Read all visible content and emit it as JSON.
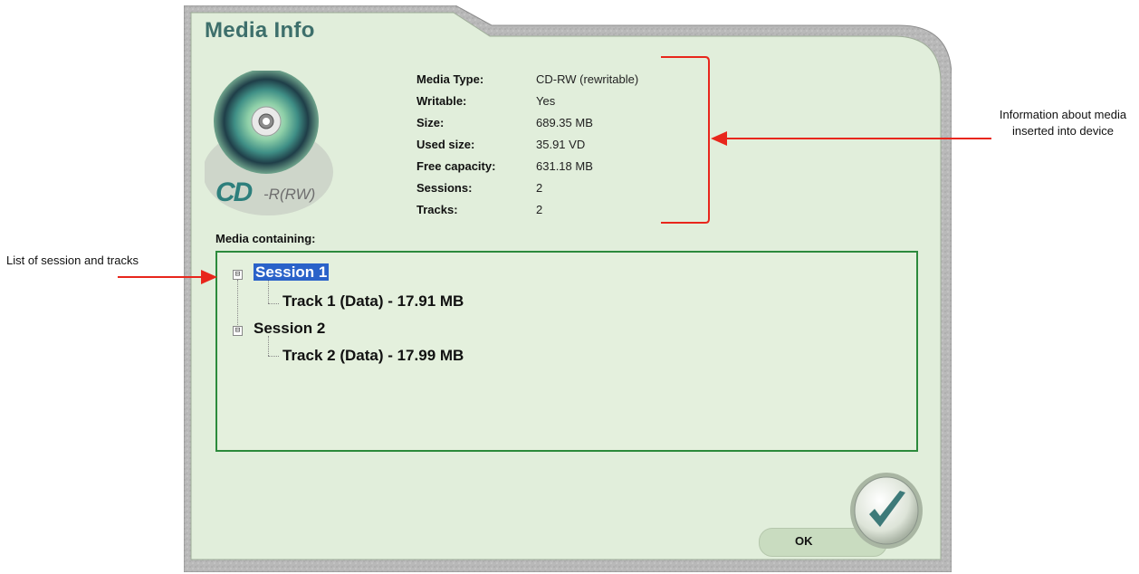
{
  "dialog": {
    "title": "Media Info",
    "logo_text": "CD",
    "logo_sub": "-R(RW)"
  },
  "info": [
    {
      "label": "Media Type:",
      "value": "CD-RW (rewritable)"
    },
    {
      "label": "Writable:",
      "value": "Yes"
    },
    {
      "label": "Size:",
      "value": "689.35 MB"
    },
    {
      "label": "Used size:",
      "value": "35.91 VD"
    },
    {
      "label": "Free capacity:",
      "value": "631.18 MB"
    },
    {
      "label": "Sessions:",
      "value": "2"
    },
    {
      "label": "Tracks:",
      "value": "2"
    }
  ],
  "media_containing_label": "Media containing:",
  "tree": {
    "session1": "Session 1",
    "track1": "Track 1 (Data) - 17.91 MB",
    "session2": "Session 2",
    "track2": "Track 2 (Data) - 17.99 MB",
    "toggle": "⊟"
  },
  "ok_label": "OK",
  "annotations": {
    "right": "Information about media inserted into device",
    "left": "List of session and tracks"
  },
  "colors": {
    "panel": "#e1eedb",
    "title": "#3d6f6b",
    "tree_border": "#2c8a3c",
    "selection": "#2a62c9",
    "arrow": "#e8261c"
  }
}
